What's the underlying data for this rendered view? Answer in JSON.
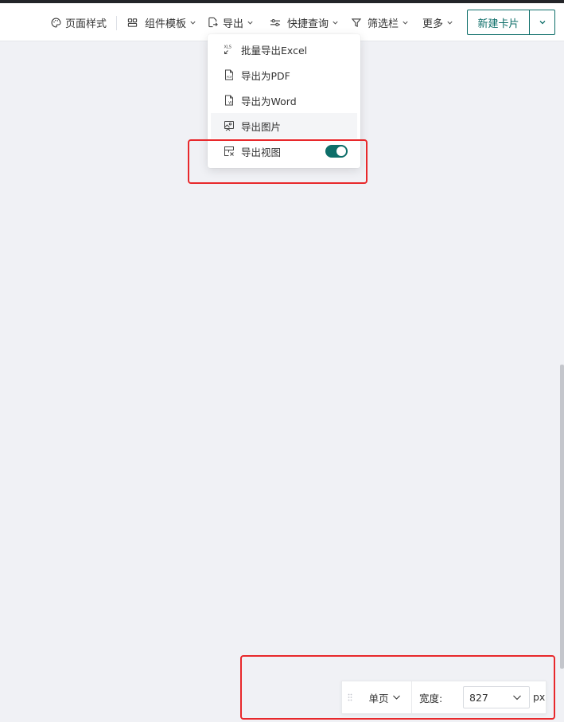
{
  "toolbar": {
    "page_style": "页面样式",
    "component_template": "组件模板",
    "export": "导出",
    "quick_query": "快捷查询",
    "filter_bar": "筛选栏",
    "more": "更多",
    "new_card": "新建卡片"
  },
  "export_menu": {
    "items": [
      {
        "label": "批量导出Excel",
        "icon": "xls-icon"
      },
      {
        "label": "导出为PDF",
        "icon": "pdf-icon"
      },
      {
        "label": "导出为Word",
        "icon": "word-icon"
      },
      {
        "label": "导出图片",
        "icon": "image-icon"
      },
      {
        "label": "导出视图",
        "icon": "view-icon",
        "toggle": true
      }
    ]
  },
  "bottom_bar": {
    "page_mode": "单页",
    "width_label": "宽度:",
    "width_value": "827",
    "unit": "px"
  },
  "colors": {
    "accent": "#0d6e69",
    "highlight": "#e8282b",
    "canvas": "#f0f1f5"
  }
}
